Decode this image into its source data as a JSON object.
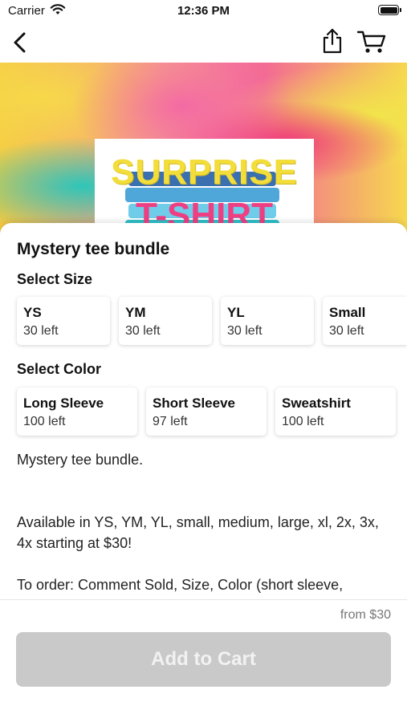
{
  "status_bar": {
    "carrier": "Carrier",
    "time": "12:36 PM"
  },
  "hero": {
    "line1": "SURPRISE",
    "line2": "T-SHIRT"
  },
  "product": {
    "title": "Mystery tee bundle",
    "size_heading": "Select Size",
    "sizes": [
      {
        "label": "YS",
        "stock": "30 left"
      },
      {
        "label": "YM",
        "stock": "30 left"
      },
      {
        "label": "YL",
        "stock": "30 left"
      },
      {
        "label": "Small",
        "stock": "30 left"
      }
    ],
    "color_heading": "Select Color",
    "colors": [
      {
        "label": "Long Sleeve",
        "stock": "100 left"
      },
      {
        "label": "Short Sleeve",
        "stock": "97 left"
      },
      {
        "label": "Sweatshirt",
        "stock": "100 left"
      }
    ],
    "description": [
      "Mystery tee bundle.",
      "Available in YS, YM, YL, small, medium, large, xl, 2x, 3x, 4x starting at $30!",
      "To order: Comment Sold, Size, Color (short sleeve,"
    ],
    "price": "from $30",
    "add_to_cart": "Add to Cart"
  },
  "colors": {
    "button_disabled": "#c9c9c9",
    "title_text": "#111111"
  },
  "icons": [
    "back-chevron-icon",
    "share-icon",
    "cart-icon",
    "wifi-icon",
    "battery-icon"
  ]
}
